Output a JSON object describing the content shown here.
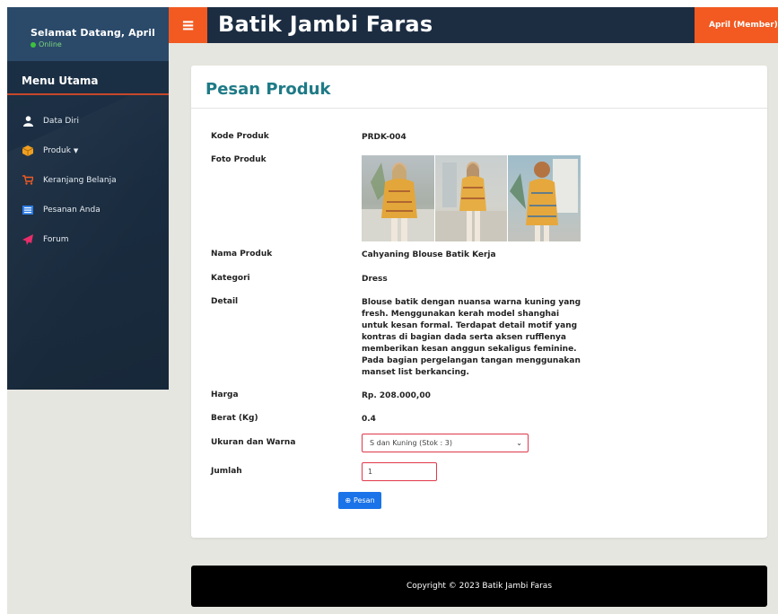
{
  "sidebar": {
    "welcome": "Selamat Datang, April",
    "status": "Online",
    "menu_header": "Menu Utama",
    "items": [
      {
        "label": "Data Diri",
        "icon": "user-icon"
      },
      {
        "label": "Produk",
        "icon": "box-icon"
      },
      {
        "label": "Keranjang Belanja",
        "icon": "cart-icon"
      },
      {
        "label": "Pesanan Anda",
        "icon": "list-icon"
      },
      {
        "label": "Forum",
        "icon": "send-icon"
      }
    ]
  },
  "header": {
    "brand": "Batik Jambi Faras",
    "menu_icon": "hamburger-icon",
    "user_menu": "April (Member)"
  },
  "card": {
    "title": "Pesan Produk",
    "fields": {
      "kode_label": "Kode Produk",
      "kode_value": "PRDK-004",
      "foto_label": "Foto Produk",
      "nama_label": "Nama Produk",
      "nama_value": "Cahyaning Blouse Batik Kerja",
      "kategori_label": "Kategori",
      "kategori_value": "Dress",
      "detail_label": "Detail",
      "detail_value": "Blouse batik dengan nuansa warna kuning yang fresh. Menggunakan kerah model shanghai untuk kesan formal. Terdapat detail motif yang kontras di bagian dada serta aksen rufflenya memberikan kesan anggun sekaligus feminine. Pada bagian pergelangan tangan menggunakan manset list berkancing.",
      "harga_label": "Harga",
      "harga_value": "Rp. 208.000,00",
      "berat_label": "Berat (Kg)",
      "berat_value": "0.4",
      "ukuran_label": "Ukuran dan Warna",
      "ukuran_selected": "S dan Kuning (Stok : 3)",
      "jumlah_label": "Jumlah",
      "jumlah_value": "1"
    },
    "order_button": "Pesan"
  },
  "footer": {
    "copyright": "Copyright © 2023 Batik Jambi Faras"
  },
  "colors": {
    "accent_orange": "#f25a21",
    "navbar": "#1c2d42",
    "title_teal": "#1e7a86",
    "button_blue": "#1a73e8",
    "field_border_red": "#e0384a"
  }
}
